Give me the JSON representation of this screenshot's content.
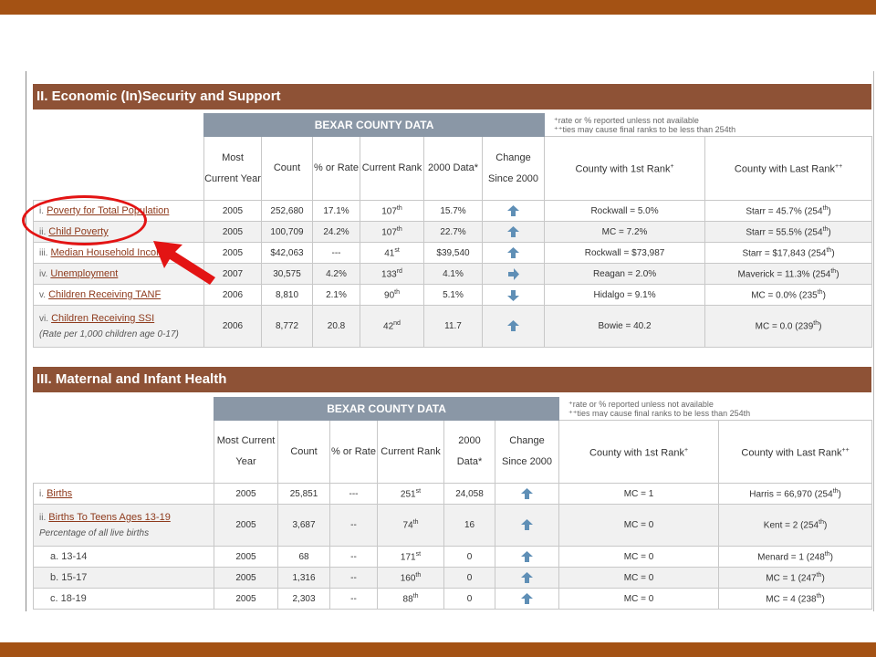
{
  "colors": {
    "band": "#a45214",
    "section_header": "#8e5236",
    "bexar_header": "#8a97a6",
    "link": "#8e3a1c",
    "arrow": "#5f8fb6",
    "highlight": "#e31414"
  },
  "section2": {
    "title": "II. Economic (In)Security and Support",
    "bexar_header": "BEXAR COUNTY DATA",
    "note1": "⁺rate or % reported unless not available",
    "note2": "⁺⁺ties may cause final ranks to be less than 254th",
    "columns": {
      "most_current_year": "Most Current Year",
      "count": "Count",
      "pct_or_rate": "% or Rate",
      "current_rank": "Current Rank",
      "data_2000": "2000 Data*",
      "change_since_2000": "Change Since 2000",
      "county_first_rank": "County with 1st Rank",
      "county_last_rank": "County with Last Rank"
    },
    "rows": [
      {
        "roman": "i.",
        "label": "Poverty for Total Population",
        "year": "2005",
        "count": "252,680",
        "rate": "17.1%",
        "rank": "107",
        "rank_sup": "th",
        "data2000": "15.7%",
        "change": "up-arrow-icon",
        "first": "Rockwall = 5.0%",
        "last": "Starr = 45.7% (254",
        "last_sup": "th",
        "last_end": ")"
      },
      {
        "roman": "ii.",
        "label": "Child Poverty",
        "year": "2005",
        "count": "100,709",
        "rate": "24.2%",
        "rank": "107",
        "rank_sup": "th",
        "data2000": "22.7%",
        "change": "up-arrow-icon",
        "first": "MC = 7.2%",
        "last": "Starr = 55.5% (254",
        "last_sup": "th",
        "last_end": ")"
      },
      {
        "roman": "iii.",
        "label": "Median Household Income",
        "year": "2005",
        "count": "$42,063",
        "rate": "---",
        "rank": "41",
        "rank_sup": "st",
        "data2000": "$39,540",
        "change": "up-arrow-icon",
        "first": "Rockwall = $73,987",
        "last": "Starr = $17,843 (254",
        "last_sup": "th",
        "last_end": ")"
      },
      {
        "roman": "iv.",
        "label": "Unemployment",
        "year": "2007",
        "count": "30,575",
        "rate": "4.2%",
        "rank": "133",
        "rank_sup": "rd",
        "data2000": "4.1%",
        "change": "right-arrow-icon",
        "first": "Reagan = 2.0%",
        "last": "Maverick = 11.3% (254",
        "last_sup": "th",
        "last_end": ")"
      },
      {
        "roman": "v.",
        "label": "Children Receiving TANF",
        "year": "2006",
        "count": "8,810",
        "rate": "2.1%",
        "rank": "90",
        "rank_sup": "th",
        "data2000": "5.1%",
        "change": "down-arrow-icon",
        "first": "Hidalgo = 9.1%",
        "last": "MC = 0.0% (235",
        "last_sup": "th",
        "last_end": ")"
      },
      {
        "roman": "vi.",
        "label": "Children Receiving SSI",
        "sub": "(Rate per 1,000 children age 0-17)",
        "year": "2006",
        "count": "8,772",
        "rate": "20.8",
        "rank": "42",
        "rank_sup": "nd",
        "data2000": "11.7",
        "change": "up-arrow-icon",
        "first": "Bowie = 40.2",
        "last": "MC = 0.0 (239",
        "last_sup": "th",
        "last_end": ")"
      }
    ]
  },
  "section3": {
    "title": "III. Maternal and Infant Health",
    "bexar_header": "BEXAR COUNTY DATA",
    "note1": "⁺rate or % reported unless not available",
    "note2": "⁺⁺ties may cause final ranks to be less than 254th",
    "columns": {
      "most_current_year": "Most Current Year",
      "count": "Count",
      "pct_or_rate": "% or Rate",
      "current_rank": "Current Rank",
      "data_2000": "2000 Data*",
      "change_since_2000": "Change Since 2000",
      "county_first_rank": "County with 1st Rank",
      "county_last_rank": "County with Last Rank"
    },
    "rows": [
      {
        "roman": "i.",
        "label": "Births",
        "year": "2005",
        "count": "25,851",
        "rate": "---",
        "rank": "251",
        "rank_sup": "st",
        "data2000": "24,058",
        "change": "up-arrow-icon",
        "first": "MC = 1",
        "last": "Harris = 66,970 (254",
        "last_sup": "th",
        "last_end": ")"
      },
      {
        "roman": "ii.",
        "label": "Births To Teens Ages 13-19",
        "sub": "Percentage of all live births",
        "year": "2005",
        "count": "3,687",
        "rate": "--",
        "rank": "74",
        "rank_sup": "th",
        "data2000": "16",
        "change": "up-arrow-icon",
        "first": "MC = 0",
        "last": "Kent = 2 (254",
        "last_sup": "th",
        "last_end": ")"
      },
      {
        "roman": "",
        "label": "a. 13-14",
        "year": "2005",
        "count": "68",
        "rate": "--",
        "rank": "171",
        "rank_sup": "st",
        "data2000": "0",
        "change": "up-arrow-icon",
        "first": "MC = 0",
        "last": "Menard = 1 (248",
        "last_sup": "th",
        "last_end": ")"
      },
      {
        "roman": "",
        "label": "b. 15-17",
        "year": "2005",
        "count": "1,316",
        "rate": "--",
        "rank": "160",
        "rank_sup": "th",
        "data2000": "0",
        "change": "up-arrow-icon",
        "first": "MC = 0",
        "last": "MC = 1 (247",
        "last_sup": "th",
        "last_end": ")"
      },
      {
        "roman": "",
        "label": "c. 18-19",
        "year": "2005",
        "count": "2,303",
        "rate": "--",
        "rank": "88",
        "rank_sup": "th",
        "data2000": "0",
        "change": "up-arrow-icon",
        "first": "MC = 0",
        "last": "MC = 4 (238",
        "last_sup": "th",
        "last_end": ")"
      }
    ]
  }
}
